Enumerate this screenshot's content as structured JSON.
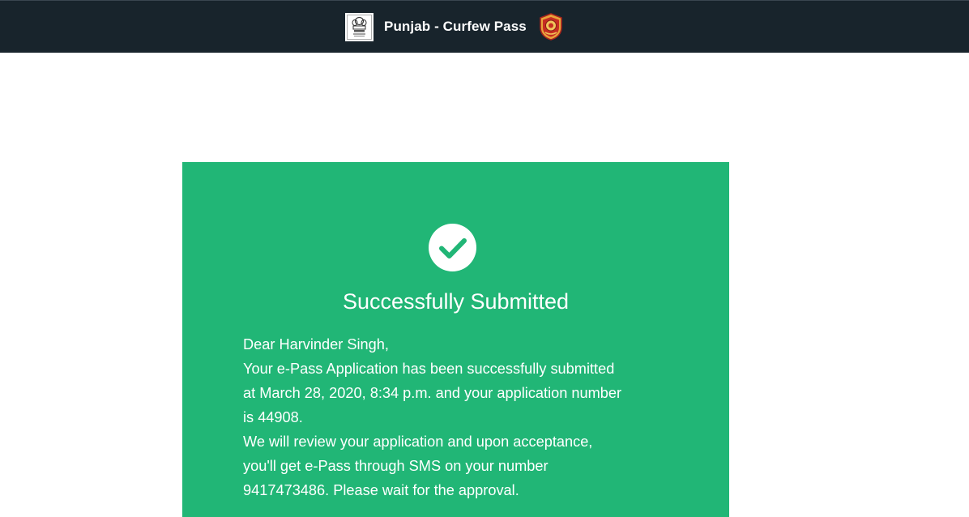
{
  "header": {
    "title": "Punjab - Curfew Pass",
    "left_logo": "state-emblem-icon",
    "right_logo": "punjab-police-badge-icon"
  },
  "card": {
    "icon": "check-circle-icon",
    "title": "Successfully Submitted",
    "lines": [
      "Dear Harvinder Singh,",
      "Your e-Pass Application has been successfully submitted",
      "at March 28, 2020, 8:34 p.m. and your application number",
      "is 44908.",
      "We will review your application and upon acceptance,",
      "you'll get e-Pass through SMS on your number",
      "9417473486. Please wait for the approval."
    ]
  },
  "colors": {
    "navbar": "#18242c",
    "card": "#21b676",
    "text_light": "#ffffff"
  }
}
